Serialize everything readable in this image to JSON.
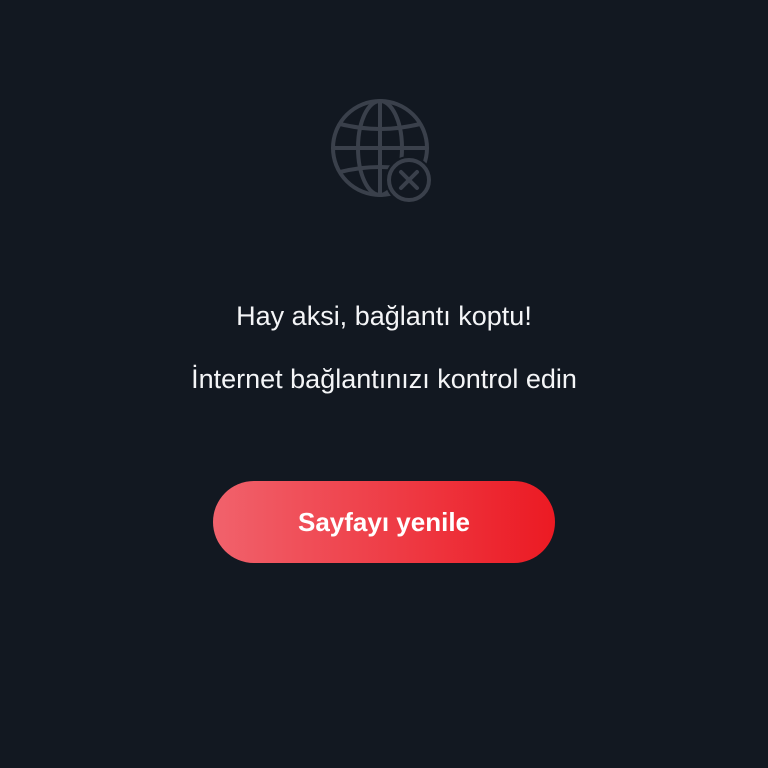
{
  "offline": {
    "icon": "globe-offline-icon",
    "title": "Hay aksi, bağlantı koptu!",
    "subtitle": "İnternet bağlantınızı kontrol edin",
    "refresh_label": "Sayfayı yenile"
  },
  "colors": {
    "background": "#121821",
    "text": "#f4f5f7",
    "icon": "#3a404b",
    "button_gradient_start": "#f1626c",
    "button_gradient_end": "#ec1a23"
  }
}
